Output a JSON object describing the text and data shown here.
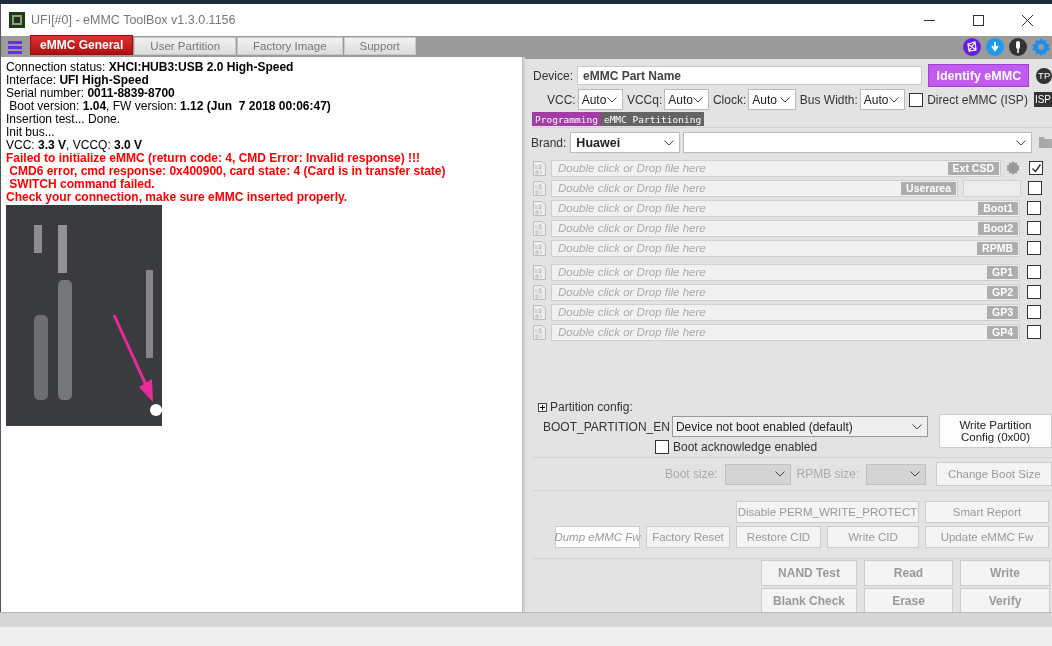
{
  "window": {
    "title": "UFI[#0] - eMMC ToolBox v1.3.0.1156"
  },
  "tabs": [
    {
      "label": "eMMC General",
      "selected": true
    },
    {
      "label": "User Partition",
      "selected": false
    },
    {
      "label": "Factory Image",
      "selected": false
    },
    {
      "label": "Support",
      "selected": false
    }
  ],
  "log": [
    {
      "kind": "info",
      "text": "Connection status: **XHCI:HUB3:USB 2.0 High-Speed**"
    },
    {
      "kind": "info",
      "text": "Interface: **UFI High-Speed**"
    },
    {
      "kind": "info",
      "text": "Serial number: **0011-8839-8700**"
    },
    {
      "kind": "info",
      "text": " Boot version: **1.04**, FW version: **1.12 (Jun  7 2018 00:06:47)**"
    },
    {
      "kind": "info",
      "text": "Insertion test... Done."
    },
    {
      "kind": "info",
      "text": "Init bus..."
    },
    {
      "kind": "info",
      "text": "VCC: **3.3 V**, VCCQ: **3.0 V**"
    },
    {
      "kind": "error",
      "text": "Failed to initialize eMMC (return code: 4, CMD Error: Invalid response) !!!"
    },
    {
      "kind": "error",
      "text": " CMD6 error, cmd response: 0x400900, card state: 4 (Card is in transfer state)"
    },
    {
      "kind": "error",
      "text": " SWITCH command failed."
    },
    {
      "kind": "error",
      "text": "Check your connection, make sure eMMC inserted properly."
    },
    {
      "kind": "picture"
    }
  ],
  "device": {
    "label": "Device:",
    "value": "eMMC Part Name",
    "identify_button": "Identify eMMC",
    "badge": "TP"
  },
  "settings": [
    {
      "label": "VCC:",
      "value": "Auto"
    },
    {
      "label": "VCCq:",
      "value": "Auto"
    },
    {
      "label": "Clock:",
      "value": "Auto"
    },
    {
      "label": "Bus Width:",
      "value": "Auto"
    }
  ],
  "direct_isp": {
    "label": "Direct eMMC (ISP)",
    "checked": false,
    "badge": "ISP"
  },
  "subtabs": [
    {
      "label": "Programming",
      "selected": true
    },
    {
      "label": "eMMC Partitioning",
      "selected": false
    }
  ],
  "brand": {
    "label": "Brand:",
    "value": "Huawei"
  },
  "partitions": [
    {
      "kind": "extcsd",
      "placeholder": "Double click or Drop file here",
      "tag": "Ext CSD",
      "checked": true
    },
    {
      "kind": "userarea",
      "placeholder": "Double click or Drop file here",
      "tag": "Userarea",
      "checked": false
    },
    {
      "kind": "plain",
      "placeholder": "Double click or Drop file here",
      "tag": "Boot1",
      "checked": false
    },
    {
      "kind": "plain",
      "placeholder": "Double click or Drop file here",
      "tag": "Boot2",
      "checked": false
    },
    {
      "kind": "plain",
      "placeholder": "Double click or Drop file here",
      "tag": "RPMB",
      "checked": false
    }
  ],
  "gp_partitions": [
    {
      "kind": "plain",
      "placeholder": "Double click or Drop file here",
      "tag": "GP1",
      "checked": false
    },
    {
      "kind": "plain",
      "placeholder": "Double click or Drop file here",
      "tag": "GP2",
      "checked": false
    },
    {
      "kind": "plain",
      "placeholder": "Double click or Drop file here",
      "tag": "GP3",
      "checked": false
    },
    {
      "kind": "plain",
      "placeholder": "Double click or Drop file here",
      "tag": "GP4",
      "checked": false
    }
  ],
  "partition_config": {
    "title": "Partition config:",
    "expanded": false,
    "boot_partition_label": "BOOT_PARTITION_EN",
    "boot_partition_value": "Device not boot enabled (default)",
    "boot_ack": {
      "label": "Boot acknowledge enabled",
      "checked": false
    },
    "write_button": "Write Partition Config (0x00)"
  },
  "boot_size": {
    "label": "Boot size:",
    "rpmb_label": "RPMB size:",
    "disabled": true,
    "button": "Change Boot Size"
  },
  "action_rows": [
    [
      {
        "kind": "spacer"
      },
      {
        "kind": "normal",
        "label": "Disable PERM_WRITE_PROTECT",
        "disabled": true
      },
      {
        "kind": "normal",
        "label": "Smart Report",
        "disabled": true
      }
    ],
    [
      {
        "kind": "italic",
        "label": "Dump eMMC Fw",
        "disabled": true
      },
      {
        "kind": "normal",
        "label": "Factory Reset",
        "disabled": true
      },
      {
        "kind": "normal",
        "label": "Restore CID",
        "disabled": true
      },
      {
        "kind": "normal",
        "label": "Write CID",
        "disabled": true
      },
      {
        "kind": "normal",
        "label": "Update eMMC Fw",
        "disabled": true
      }
    ]
  ],
  "main_buttons": [
    [
      {
        "label": "NAND Test",
        "disabled": true
      },
      {
        "label": "Read",
        "disabled": true
      },
      {
        "label": "Write",
        "disabled": true
      }
    ],
    [
      {
        "label": "Blank Check",
        "disabled": true
      },
      {
        "label": "Erase",
        "disabled": true
      },
      {
        "label": "Verify",
        "disabled": true
      }
    ]
  ]
}
